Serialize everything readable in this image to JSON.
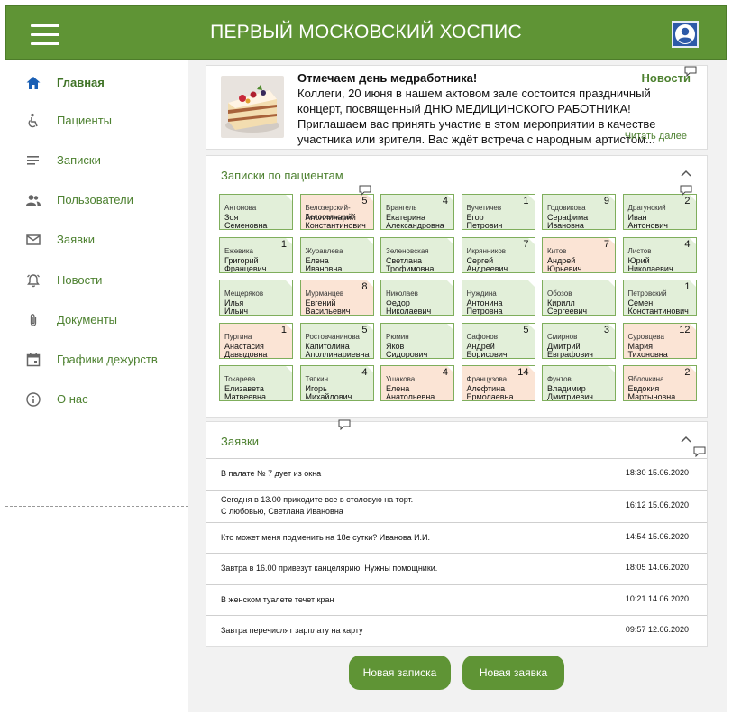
{
  "header": {
    "title": "ПЕРВЫЙ МОСКОВСКИЙ ХОСПИС",
    "menu_icon": "hamburger-icon",
    "avatar_icon": "user-avatar-icon"
  },
  "sidebar": {
    "items": [
      {
        "label": "Главная",
        "icon": "home-icon",
        "active": true
      },
      {
        "label": "Пациенты",
        "icon": "accessibility-icon"
      },
      {
        "label": "Записки",
        "icon": "notes-icon"
      },
      {
        "label": "Пользователи",
        "icon": "users-icon"
      },
      {
        "label": "Заявки",
        "icon": "mail-icon"
      },
      {
        "label": "Новости",
        "icon": "bell-icon"
      },
      {
        "label": "Документы",
        "icon": "paperclip-icon"
      },
      {
        "label": "Графики дежурств",
        "icon": "calendar-icon"
      },
      {
        "label": "О нас",
        "icon": "info-icon"
      }
    ]
  },
  "news": {
    "title": "Отмечаем день медработника!",
    "text": "Коллеги, 20 июня в нашем актовом зале состоится праздничный концерт, посвященный ДНЮ МЕДИЦИНСКОГО РАБОТНИКА! Приглашаем вас принять участие в этом мероприятии в качестве участника или зрителя. Вас ждёт встреча с народным артистом...",
    "tag": "Новости",
    "more": "Читать далее"
  },
  "notes": {
    "title": "Записки по пациентам",
    "patients": [
      {
        "last": "Антонова",
        "first": "Зоя",
        "middle": "Семеновна",
        "count": "",
        "color": "green"
      },
      {
        "last": "Белозерский-Белосельский",
        "first": "Аполлинарий",
        "middle": "Константинович",
        "count": "5",
        "color": "peach"
      },
      {
        "last": "Врангель",
        "first": "Екатерина",
        "middle": "Александровна",
        "count": "4",
        "color": "green"
      },
      {
        "last": "Вучетичев",
        "first": "Егор",
        "middle": "Петрович",
        "count": "1",
        "color": "green"
      },
      {
        "last": "Годовикова",
        "first": "Серафима",
        "middle": "Ивановна",
        "count": "9",
        "color": "green"
      },
      {
        "last": "Драгунский",
        "first": "Иван",
        "middle": "Антонович",
        "count": "2",
        "color": "green"
      },
      {
        "last": "Ежевика",
        "first": "Григорий",
        "middle": "Францевич",
        "count": "1",
        "color": "green"
      },
      {
        "last": "Журавлева",
        "first": "Елена",
        "middle": "Ивановна",
        "count": "",
        "color": "green"
      },
      {
        "last": "Зеленовская",
        "first": "Светлана",
        "middle": "Трофимовна",
        "count": "",
        "color": "green"
      },
      {
        "last": "Икрянников",
        "first": "Сергей",
        "middle": "Андреевич",
        "count": "7",
        "color": "green"
      },
      {
        "last": "Китов",
        "first": "Андрей",
        "middle": "Юрьевич",
        "count": "7",
        "color": "peach"
      },
      {
        "last": "Листов",
        "first": "Юрий",
        "middle": "Николаевич",
        "count": "4",
        "color": "green"
      },
      {
        "last": "Мещеряков",
        "first": "Илья",
        "middle": "Ильич",
        "count": "",
        "color": "green"
      },
      {
        "last": "Мурманцев",
        "first": "Евгений",
        "middle": "Васильевич",
        "count": "8",
        "color": "peach"
      },
      {
        "last": "Николаев",
        "first": "Федор",
        "middle": "Николаевич",
        "count": "",
        "color": "green"
      },
      {
        "last": "Нуждина",
        "first": "Антонина",
        "middle": "Петровна",
        "count": "",
        "color": "green"
      },
      {
        "last": "Обозов",
        "first": "Кирилл",
        "middle": "Сергеевич",
        "count": "",
        "color": "green"
      },
      {
        "last": "Петровский",
        "first": "Семен",
        "middle": "Константинович",
        "count": "1",
        "color": "green"
      },
      {
        "last": "Пургина",
        "first": "Анастасия",
        "middle": "Давыдовна",
        "count": "1",
        "color": "peach"
      },
      {
        "last": "Ростовчанинова",
        "first": "Капитолина",
        "middle": "Аполлинариевна",
        "count": "5",
        "color": "green"
      },
      {
        "last": "Рюмин",
        "first": "Яков",
        "middle": "Сидорович",
        "count": "",
        "color": "green"
      },
      {
        "last": "Сафонов",
        "first": "Андрей",
        "middle": "Борисович",
        "count": "5",
        "color": "green"
      },
      {
        "last": "Смирнов",
        "first": "Дмитрий",
        "middle": "Евграфович",
        "count": "3",
        "color": "green"
      },
      {
        "last": "Суровцева",
        "first": "Мария",
        "middle": "Тихоновна",
        "count": "12",
        "color": "peach"
      },
      {
        "last": "Токарева",
        "first": "Елизавета",
        "middle": "Матвеевна",
        "count": "",
        "color": "green"
      },
      {
        "last": "Тяпкин",
        "first": "Игорь",
        "middle": "Михайлович",
        "count": "4",
        "color": "green"
      },
      {
        "last": "Ушакова",
        "first": "Елена",
        "middle": "Анатольевна",
        "count": "4",
        "color": "peach"
      },
      {
        "last": "Французова",
        "first": "Алефтина",
        "middle": "Ермолаевна",
        "count": "14",
        "color": "peach"
      },
      {
        "last": "Фунтов",
        "first": "Владимир",
        "middle": "Дмитриевич",
        "count": "",
        "color": "green"
      },
      {
        "last": "Яблочкина",
        "first": "Евдокия",
        "middle": "Мартыновна",
        "count": "2",
        "color": "peach"
      }
    ]
  },
  "requests": {
    "title": "Заявки",
    "items": [
      {
        "text": "В палате № 7 дует из окна",
        "text2": "",
        "time": "18:30 15.06.2020"
      },
      {
        "text": "Сегодня в 13.00 приходите все в столовую на торт.",
        "text2": "С любовью, Светлана Ивановна",
        "time": "16:12 15.06.2020"
      },
      {
        "text": "Кто может меня подменить на 18е сутки? Иванова И.И.",
        "text2": "",
        "time": "14:54 15.06.2020"
      },
      {
        "text": "Завтра в 16.00 привезут канцелярию. Нужны помощники.",
        "text2": "",
        "time": "18:05 14.06.2020"
      },
      {
        "text": "В женском туалете течет кран",
        "text2": "",
        "time": "10:21 14.06.2020"
      },
      {
        "text": "Завтра перечислят зарплату на карту",
        "text2": "",
        "time": "09:57 12.06.2020"
      }
    ]
  },
  "buttons": {
    "new_note": "Новая записка",
    "new_request": "Новая заявка"
  },
  "colors": {
    "brand_green": "#5f9435",
    "card_green": "#e2efd9",
    "card_peach": "#fbe4d5",
    "link_green": "#4d8130"
  }
}
